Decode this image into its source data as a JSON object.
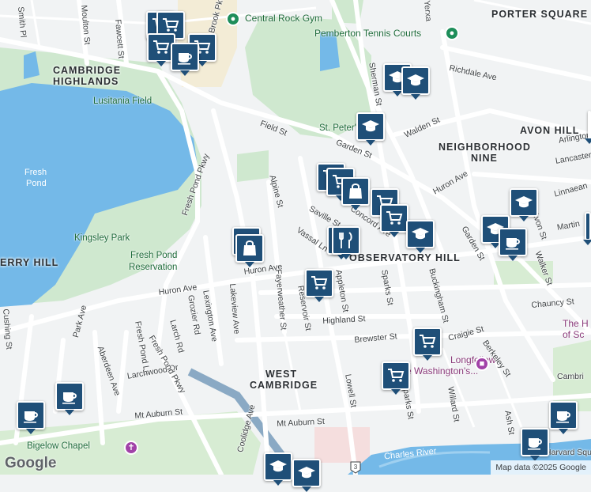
{
  "map": {
    "neighborhoods": [
      "PORTER SQUARE",
      "CAMBRIDGE",
      "HIGHLANDS",
      "AVON HILL",
      "NEIGHBORHOOD",
      "NINE",
      "OBSERVATORY HILL",
      "WEST",
      "CAMBRIDGE",
      "ERRY HILL"
    ],
    "parks": [
      "Lusitania Field",
      "Kingsley Park",
      "Fresh Pond",
      "Reservation",
      "St. Peter's Field",
      "Bigelow Chapel"
    ],
    "water": [
      "Fresh",
      "Pond",
      "Charles River"
    ],
    "pois": [
      "Central Rock Gym",
      "Pemberton Tennis Courts",
      "Longfellow",
      "House Washington's...",
      "The H",
      "of Sc"
    ],
    "streets": [
      "Smith Pl",
      "Moulton St",
      "Fawcett St",
      "Brook Pkwy",
      "Yerxa",
      "Sherman St",
      "Richdale Ave",
      "Field St",
      "Garden St",
      "Walden St",
      "Arlington",
      "Lancaster",
      "Linnaean",
      "Huron Ave",
      "Concord Ave",
      "Saville St",
      "Vassal Ln",
      "Alpine St",
      "Fresh Pond Pkwy",
      "Martin",
      "Avon St",
      "Walker St",
      "Garden St",
      "Chauncy St",
      "Huron Ave",
      "Huron Ave",
      "Fayerweather St",
      "Lakeview Ave",
      "Lexington Ave",
      "Grozier Rd",
      "Larch Rd",
      "Fresh Pond Ln",
      "Park Ave",
      "Aberdeen Ave",
      "Cushing St",
      "Larchwood Dr",
      "Reservoir St",
      "Appleton St",
      "Sparks St",
      "Buckingham St",
      "Highland St",
      "Brewster St",
      "Craigie St",
      "Berkeley St",
      "Lowell St",
      "Sparks St",
      "Willard St",
      "Ash St",
      "Mt Auburn St",
      "Mt Auburn St",
      "Coolidge Ave",
      "Fresh Pond Pkwy",
      "Cambri",
      "Harvard Square"
    ],
    "marker_icons": [
      "shopping-cart-icon",
      "coffee-cup-icon",
      "graduation-cap-icon",
      "shopping-bag-icon",
      "fork-knife-icon"
    ],
    "route_shield": "3",
    "google_logo": "Google",
    "attribution": "Map data ©2025 Google"
  }
}
